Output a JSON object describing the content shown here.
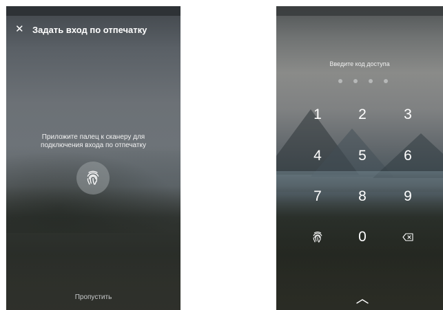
{
  "setup_screen": {
    "title": "Задать вход по отпечатку",
    "close_icon": "close-icon",
    "instruction_line1": "Приложите палец к сканеру для",
    "instruction_line2": "подключения входа по отпечатку",
    "fingerprint_icon": "fingerprint-icon",
    "skip_label": "Пропустить"
  },
  "passcode_screen": {
    "title": "Введите код доступа",
    "pin_length": 4,
    "pin_entered": 0,
    "keys": {
      "k1": "1",
      "k2": "2",
      "k3": "3",
      "k4": "4",
      "k5": "5",
      "k6": "6",
      "k7": "7",
      "k8": "8",
      "k9": "9",
      "k0": "0"
    },
    "fingerprint_key_icon": "fingerprint-icon",
    "backspace_icon": "backspace-icon",
    "expand_icon": "chevron-up-icon"
  },
  "colors": {
    "text_primary": "#ffffff",
    "text_muted": "#c8cacc",
    "dot_color": "#dcdee0"
  }
}
